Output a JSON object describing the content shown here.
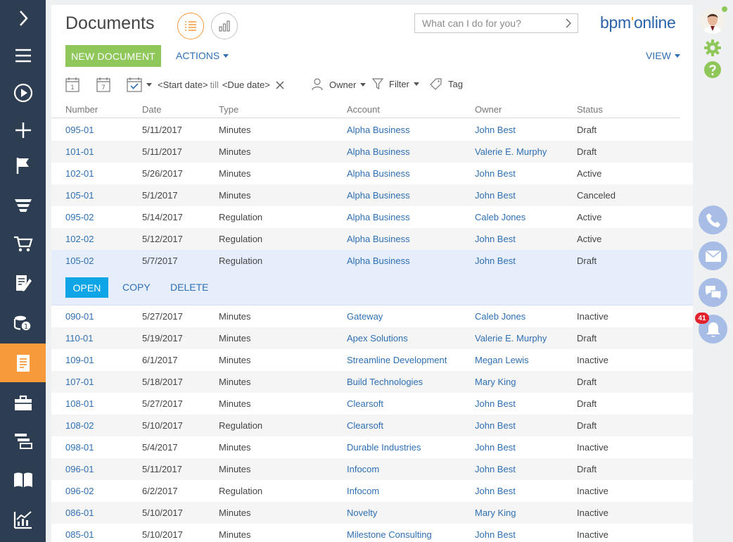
{
  "page": {
    "title": "Documents"
  },
  "search": {
    "placeholder": "What can I do for you?"
  },
  "logo": {
    "prefix": "bpm",
    "dot": "'",
    "suffix": "online"
  },
  "toolbar": {
    "new_label": "NEW DOCUMENT",
    "actions_label": "ACTIONS",
    "view_label": "VIEW"
  },
  "filters": {
    "start_date": "<Start date>",
    "till": "till",
    "due_date": "<Due date>",
    "owner_label": "Owner",
    "filter_label": "Filter",
    "tag_label": "Tag",
    "calendar_day": "1",
    "calendar_week": "7"
  },
  "columns": {
    "number": "Number",
    "date": "Date",
    "type": "Type",
    "account": "Account",
    "owner": "Owner",
    "status": "Status"
  },
  "rows_top": [
    {
      "number": "095-01",
      "date": "5/11/2017",
      "type": "Minutes",
      "account": "Alpha Business",
      "owner": "John Best",
      "status": "Draft"
    },
    {
      "number": "101-01",
      "date": "5/11/2017",
      "type": "Minutes",
      "account": "Alpha Business",
      "owner": "Valerie E. Murphy",
      "status": "Draft"
    },
    {
      "number": "102-01",
      "date": "5/26/2017",
      "type": "Minutes",
      "account": "Alpha Business",
      "owner": "John Best",
      "status": "Active"
    },
    {
      "number": "105-01",
      "date": "5/1/2017",
      "type": "Minutes",
      "account": "Alpha Business",
      "owner": "John Best",
      "status": "Canceled"
    },
    {
      "number": "095-02",
      "date": "5/14/2017",
      "type": "Regulation",
      "account": "Alpha Business",
      "owner": "Caleb Jones",
      "status": "Active"
    },
    {
      "number": "102-02",
      "date": "5/12/2017",
      "type": "Regulation",
      "account": "Alpha Business",
      "owner": "John Best",
      "status": "Active"
    }
  ],
  "selected_row": {
    "number": "105-02",
    "date": "5/7/2017",
    "type": "Regulation",
    "account": "Alpha Business",
    "owner": "John Best",
    "status": "Draft"
  },
  "row_actions": {
    "open": "OPEN",
    "copy": "COPY",
    "delete": "DELETE"
  },
  "rows_bottom": [
    {
      "number": "090-01",
      "date": "5/27/2017",
      "type": "Minutes",
      "account": "Gateway",
      "owner": "Caleb Jones",
      "status": "Inactive"
    },
    {
      "number": "110-01",
      "date": "5/19/2017",
      "type": "Minutes",
      "account": "Apex Solutions",
      "owner": "Valerie E. Murphy",
      "status": "Draft"
    },
    {
      "number": "109-01",
      "date": "6/1/2017",
      "type": "Minutes",
      "account": "Streamline Development",
      "owner": "Megan Lewis",
      "status": "Inactive"
    },
    {
      "number": "107-01",
      "date": "5/18/2017",
      "type": "Minutes",
      "account": "Build Technologies",
      "owner": "Mary King",
      "status": "Draft"
    },
    {
      "number": "108-01",
      "date": "5/27/2017",
      "type": "Minutes",
      "account": "Clearsoft",
      "owner": "John Best",
      "status": "Draft"
    },
    {
      "number": "108-02",
      "date": "5/10/2017",
      "type": "Regulation",
      "account": "Clearsoft",
      "owner": "John Best",
      "status": "Draft"
    },
    {
      "number": "098-01",
      "date": "5/4/2017",
      "type": "Minutes",
      "account": "Durable Industries",
      "owner": "John Best",
      "status": "Inactive"
    },
    {
      "number": "096-01",
      "date": "5/11/2017",
      "type": "Minutes",
      "account": "Infocom",
      "owner": "John Best",
      "status": "Draft"
    },
    {
      "number": "096-02",
      "date": "6/2/2017",
      "type": "Regulation",
      "account": "Infocom",
      "owner": "John Best",
      "status": "Inactive"
    },
    {
      "number": "086-01",
      "date": "5/10/2017",
      "type": "Minutes",
      "account": "Novelty",
      "owner": "Mary King",
      "status": "Inactive"
    },
    {
      "number": "085-01",
      "date": "5/10/2017",
      "type": "Minutes",
      "account": "Milestone Consulting",
      "owner": "John Best",
      "status": "Inactive"
    }
  ],
  "notifications": {
    "count": "41"
  },
  "colors": {
    "nav_bg": "#2d3e53",
    "nav_active": "#f79a3b",
    "accent_green": "#8fc75b",
    "link_blue": "#2f6fb3",
    "open_blue": "#0ea5e6",
    "comm_blue": "#a7bde6",
    "badge_red": "#e4222b"
  },
  "nav_items": [
    "chevron-right-icon",
    "menu-icon",
    "play-icon",
    "plus-icon",
    "flag-icon",
    "funnel-icon",
    "cart-icon",
    "edit-document-icon",
    "coins-icon",
    "document-icon",
    "briefcase-icon",
    "stacked-cards-icon",
    "book-icon",
    "chart-icon"
  ]
}
